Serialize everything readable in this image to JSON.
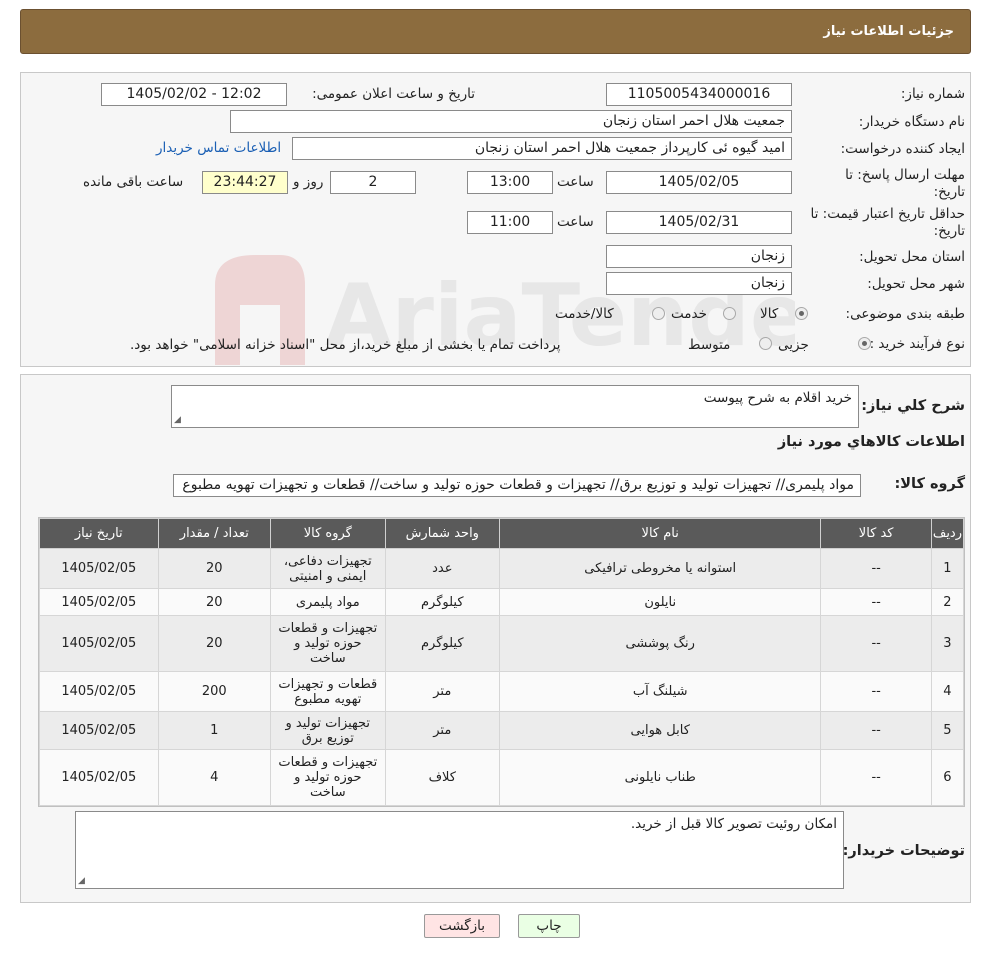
{
  "header": {
    "title": "جزئیات اطلاعات نیاز"
  },
  "form": {
    "need_number_label": "شماره نیاز:",
    "need_number": "1105005434000016",
    "announce_label": "تاریخ و ساعت اعلان عمومی:",
    "announce_value": "1405/02/02 - 12:02",
    "buyer_org_label": "نام دستگاه خریدار:",
    "buyer_org": "جمعیت هلال احمر استان زنجان",
    "creator_label": "ایجاد کننده درخواست:",
    "creator": "امید گیوه ئی کارپرداز  جمعیت هلال احمر استان زنجان",
    "contact_link": "اطلاعات تماس خریدار",
    "deadline_label": "مهلت ارسال پاسخ: تا تاریخ:",
    "deadline_date": "1405/02/05",
    "time_label": "ساعت",
    "deadline_time": "13:00",
    "days_value": "2",
    "days_label": "روز و",
    "remaining_time": "23:44:27",
    "remaining_label": "ساعت باقی مانده",
    "validity_label": "حداقل تاریخ اعتبار قیمت: تا تاریخ:",
    "validity_date": "1405/02/31",
    "validity_time": "11:00",
    "province_label": "استان محل تحویل:",
    "province": "زنجان",
    "city_label": "شهر محل تحویل:",
    "city": "زنجان",
    "category_label": "طبقه بندی موضوعی:",
    "category_options": [
      "کالا",
      "خدمت",
      "کالا/خدمت"
    ],
    "process_label": "نوع فرآیند خرید :",
    "process_options": [
      "جزیی",
      "متوسط"
    ],
    "payment_note": "پرداخت تمام یا بخشی از مبلغ خرید،از محل \"اسناد خزانه اسلامی\" خواهد بود."
  },
  "details": {
    "summary_label": "شرح کلي نياز:",
    "summary_value": "خرید اقلام به شرح پیوست",
    "goods_title": "اطلاعات کالاهاي مورد نياز",
    "group_label": "گروه کالا:",
    "group_value": "مواد پلیمری// تجهیزات تولید و توزیع برق// تجهیزات و قطعات حوزه تولید و ساخت//  قطعات و تجهیزات تهویه مطبوع",
    "buyer_notes_label": "توضیحات خریدار:",
    "buyer_notes": "امکان روئیت تصویر کالا قبل از خرید."
  },
  "table": {
    "headers": [
      "رديف",
      "کد کالا",
      "نام کالا",
      "واحد شمارش",
      "گروه کالا",
      "تعداد / مقدار",
      "تاریخ نیاز"
    ],
    "rows": [
      [
        "1",
        "--",
        "استوانه یا مخروطی ترافیکی",
        "عدد",
        "تجهیزات دفاعی، ایمنی و امنیتی",
        "20",
        "1405/02/05"
      ],
      [
        "2",
        "--",
        "نایلون",
        "کیلوگرم",
        "مواد پلیمری",
        "20",
        "1405/02/05"
      ],
      [
        "3",
        "--",
        "رنگ پوششی",
        "کیلوگرم",
        "تجهیزات و قطعات حوزه تولید و ساخت",
        "20",
        "1405/02/05"
      ],
      [
        "4",
        "--",
        "شیلنگ آب",
        "متر",
        "قطعات و تجهیزات تهویه مطبوع",
        "200",
        "1405/02/05"
      ],
      [
        "5",
        "--",
        "کابل هوایی",
        "متر",
        "تجهیزات تولید و توزیع برق",
        "1",
        "1405/02/05"
      ],
      [
        "6",
        "--",
        "طناب نایلونی",
        "کلاف",
        "تجهیزات و قطعات حوزه تولید و ساخت",
        "4",
        "1405/02/05"
      ]
    ]
  },
  "buttons": {
    "print": "چاپ",
    "back": "بازگشت"
  },
  "watermark": {
    "text": "AriaTender.neT"
  },
  "colors": {
    "header_bg": "#8c6c3e",
    "table_header_bg": "#5a5a5a",
    "remaining_bg": "#ffffcc",
    "back_button_bg": "#ffe4e4",
    "print_button_bg": "#eaffe4"
  }
}
